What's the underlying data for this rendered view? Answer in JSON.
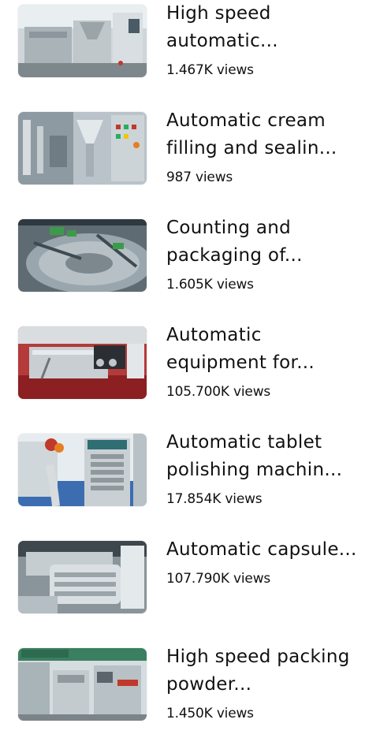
{
  "videos": [
    {
      "title": "High speed automatic...",
      "views": "1.467K views"
    },
    {
      "title": "Automatic cream filling and sealin...",
      "views": "987 views"
    },
    {
      "title": "Counting and packaging of...",
      "views": "1.605K views"
    },
    {
      "title": "Automatic equipment for...",
      "views": "105.700K views"
    },
    {
      "title": "Automatic tablet polishing machin...",
      "views": "17.854K views"
    },
    {
      "title": "Automatic capsule...",
      "views": "107.790K views"
    },
    {
      "title": "High speed packing powder...",
      "views": "1.450K views"
    }
  ]
}
